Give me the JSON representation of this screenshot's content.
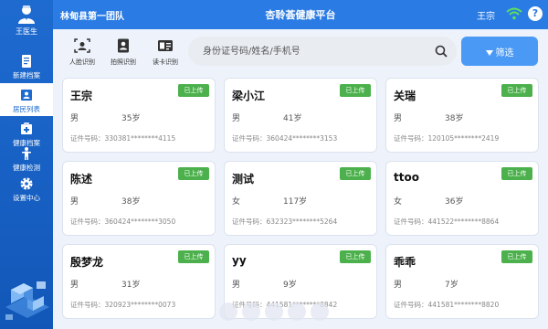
{
  "sidebar": {
    "doctor_name": "王医生",
    "items": [
      {
        "label": "新建档案",
        "icon": "new-file-icon"
      },
      {
        "label": "居民列表",
        "icon": "resident-list-icon"
      },
      {
        "label": "健康档案",
        "icon": "health-record-icon"
      },
      {
        "label": "健康检测",
        "icon": "health-check-icon"
      },
      {
        "label": "设置中心",
        "icon": "settings-gear-icon"
      }
    ],
    "active_index": 1
  },
  "header": {
    "team": "林甸县第一团队",
    "title": "杏聆荟健康平台",
    "user": "王宗"
  },
  "toolbar": {
    "tools": [
      {
        "label": "人脸识别",
        "icon": "face-recognition-icon"
      },
      {
        "label": "拍照识别",
        "icon": "photo-id-icon"
      },
      {
        "label": "读卡识别",
        "icon": "card-reader-icon"
      }
    ],
    "search_placeholder": "身份证号码/姓名/手机号",
    "filter_label": "筛选"
  },
  "colors": {
    "primary": "#2a7be4",
    "sidebar": "#1e6bd0",
    "badge_green": "#4cb14c"
  },
  "residents": [
    {
      "name": "王宗",
      "gender": "男",
      "age": "35岁",
      "id_label": "证件号码：",
      "id": "330381********4115",
      "status": "已上传"
    },
    {
      "name": "梁小江",
      "gender": "男",
      "age": "41岁",
      "id_label": "证件号码：",
      "id": "360424********3153",
      "status": "已上传"
    },
    {
      "name": "关瑞",
      "gender": "男",
      "age": "38岁",
      "id_label": "证件号码：",
      "id": "120105********2419",
      "status": "已上传"
    },
    {
      "name": "陈述",
      "gender": "男",
      "age": "38岁",
      "id_label": "证件号码：",
      "id": "360424********3050",
      "status": "已上传"
    },
    {
      "name": "测试",
      "gender": "女",
      "age": "117岁",
      "id_label": "证件号码：",
      "id": "632323********5264",
      "status": "已上传"
    },
    {
      "name": "ttoo",
      "gender": "女",
      "age": "36岁",
      "id_label": "证件号码：",
      "id": "441522********8864",
      "status": "已上传"
    },
    {
      "name": "殷梦龙",
      "gender": "男",
      "age": "31岁",
      "id_label": "证件号码：",
      "id": "320923********0073",
      "status": "已上传"
    },
    {
      "name": "yy",
      "gender": "男",
      "age": "9岁",
      "id_label": "证件号码：",
      "id": "441581********8842",
      "status": "已上传"
    },
    {
      "name": "乖乖",
      "gender": "男",
      "age": "7岁",
      "id_label": "证件号码：",
      "id": "441581********8820",
      "status": "已上传"
    }
  ]
}
